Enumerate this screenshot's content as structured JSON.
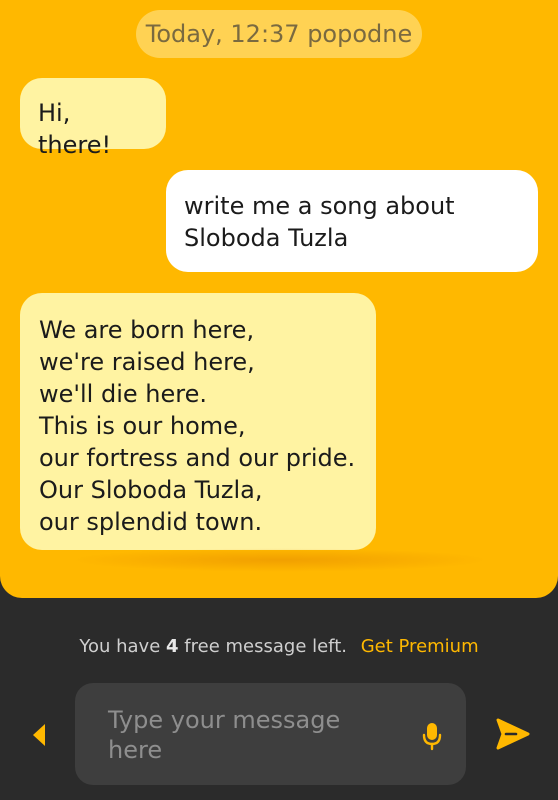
{
  "header": {
    "date_label": "Today, 12:37 popodne"
  },
  "messages": [
    {
      "sender": "bot",
      "text": "Hi, there!"
    },
    {
      "sender": "user",
      "text": "write me a song about\nSloboda Tuzla"
    },
    {
      "sender": "bot",
      "text": "We are born here,\nwe're raised here,\nwe'll die here.\nThis is our home,\nour fortress and our pride.\nOur Sloboda Tuzla,\nour splendid town."
    }
  ],
  "quota": {
    "prefix": "You have",
    "count": "4",
    "suffix": "free message left.",
    "premium_link": "Get Premium"
  },
  "composer": {
    "placeholder": "Type your message here"
  },
  "icons": {
    "back": "triangle-left-icon",
    "mic": "microphone-icon",
    "send": "send-icon"
  },
  "colors": {
    "chat_background": "#ffb800",
    "bot_bubble": "#fff3a2",
    "user_bubble": "#ffffff",
    "footer_background": "#2b2b2b",
    "accent": "#ffb800"
  }
}
